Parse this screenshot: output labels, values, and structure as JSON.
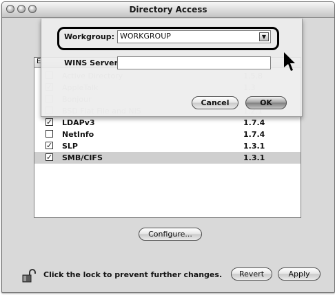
{
  "window": {
    "title": "Directory Access"
  },
  "services": {
    "column_header": "E",
    "rows": [
      {
        "name": "Active Directory",
        "version": "1.5.8",
        "checked": false,
        "faded": true
      },
      {
        "name": "AppleTalk",
        "version": "1.3",
        "checked": true,
        "faded": true
      },
      {
        "name": "Bonjour",
        "version": "",
        "checked": false,
        "faded": true
      },
      {
        "name": "BSD Flat File and NIS",
        "version": "1.2.1",
        "checked": false,
        "faded": true
      },
      {
        "name": "LDAPv3",
        "version": "1.7.4",
        "checked": true,
        "faded": false
      },
      {
        "name": "NetInfo",
        "version": "1.7.4",
        "checked": false,
        "faded": false
      },
      {
        "name": "SLP",
        "version": "1.3.1",
        "checked": true,
        "faded": false
      },
      {
        "name": "SMB/CIFS",
        "version": "1.3.1",
        "checked": true,
        "faded": false,
        "selected": true
      }
    ]
  },
  "sheet": {
    "workgroup_label": "Workgroup:",
    "workgroup_value": "WORKGROUP",
    "wins_label": "WINS Server:",
    "wins_value": "",
    "cancel_label": "Cancel",
    "ok_label": "OK"
  },
  "configure_label": "Configure...",
  "footer": {
    "lock_text": "Click the lock to prevent further changes.",
    "revert_label": "Revert",
    "apply_label": "Apply"
  }
}
